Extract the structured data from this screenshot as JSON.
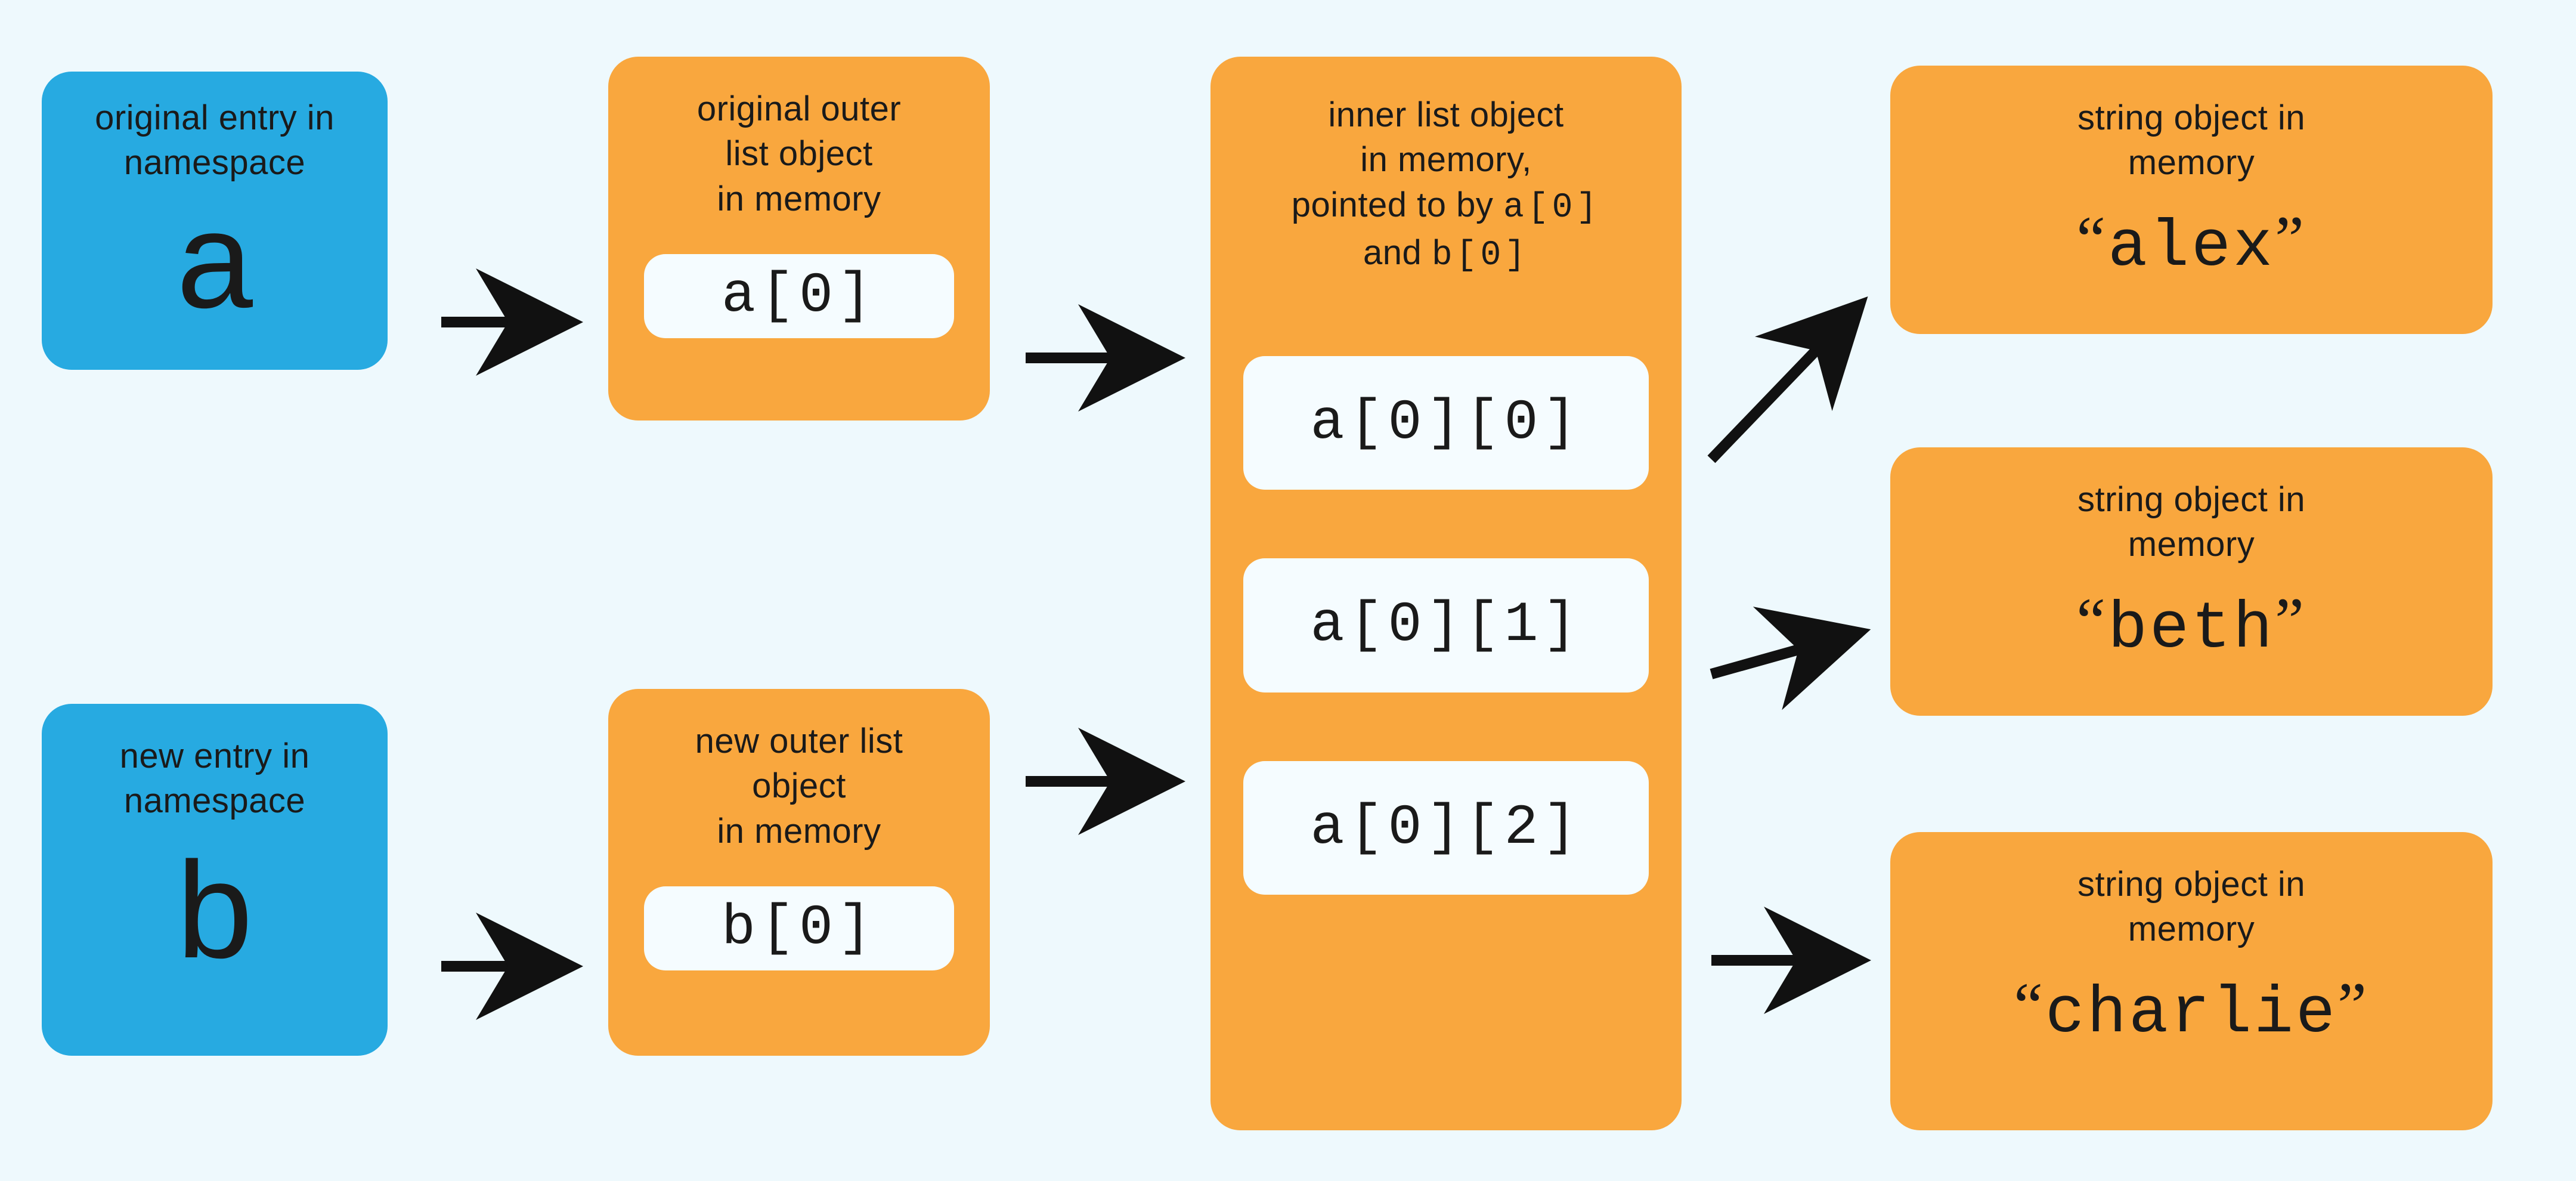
{
  "namespace_a": {
    "caption": "original entry in namespace",
    "var": "a"
  },
  "namespace_b": {
    "caption": "new entry in namespace",
    "var": "b"
  },
  "outer_a": {
    "caption1": "original outer",
    "caption2": "list object",
    "caption3": "in memory",
    "slot": "a[0]"
  },
  "outer_b": {
    "caption1": "new outer list",
    "caption2": "object",
    "caption3": "in memory",
    "slot": "b[0]"
  },
  "inner": {
    "caption1": "inner list object",
    "caption2": "in memory,",
    "caption3_pre": "pointed to by ",
    "caption3_code": "a[0]",
    "caption4_pre": "and  ",
    "caption4_code": "b[0]",
    "slots": [
      "a[0][0]",
      "a[0][1]",
      "a[0][2]"
    ]
  },
  "str_alex": {
    "caption1": "string object in",
    "caption2": "memory",
    "value": "alex"
  },
  "str_beth": {
    "caption1": "string object in",
    "caption2": "memory",
    "value": "beth"
  },
  "str_charlie": {
    "caption1": "string object in",
    "caption2": "memory",
    "value": "charlie"
  },
  "colors": {
    "blue": "#27aae1",
    "orange": "#f9a73e",
    "bg": "#eef9fd"
  }
}
